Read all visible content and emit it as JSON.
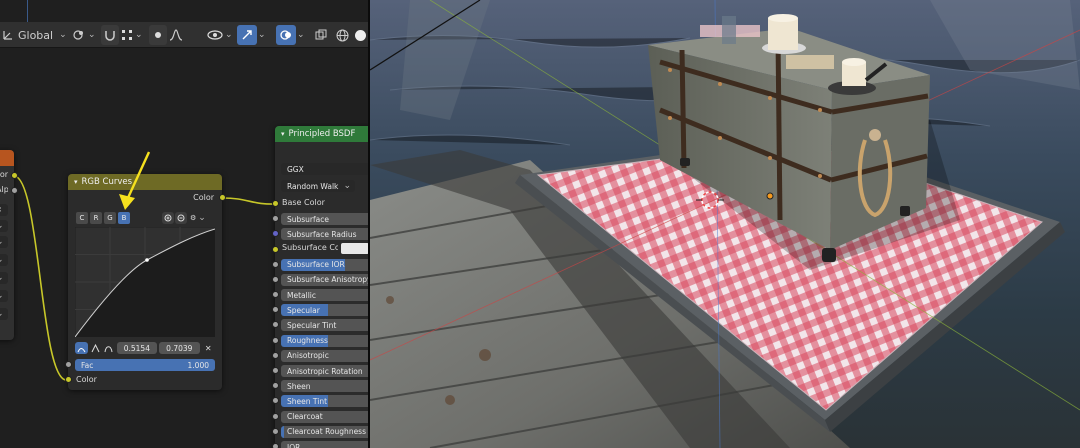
{
  "header": {
    "transform_orientation": "Global"
  },
  "left_node_fragment": {
    "label_color": "Color",
    "label_alpha": "Alpha"
  },
  "rgb_curves": {
    "title": "RGB Curves",
    "channels": [
      "C",
      "R",
      "G",
      "B"
    ],
    "active_channel": "B",
    "output_label": "Color",
    "point_x": "0.5154",
    "point_y": "0.7039",
    "fac_label": "Fac",
    "fac_value": "1.000",
    "input_color_label": "Color"
  },
  "principled_bsdf": {
    "title": "Principled BSDF",
    "distribution": "GGX",
    "subsurface_method": "Random Walk",
    "base_color_label": "Base Color",
    "subsurface_color_label": "Subsurface Co...",
    "inputs": [
      {
        "label": "Subsurface",
        "fill": 0.0
      },
      {
        "label": "Subsurface Radius",
        "fill": 0.0
      },
      {
        "label": "Subsurface IOR",
        "fill": 0.68
      },
      {
        "label": "Subsurface Anisotropy",
        "fill": 0.0
      },
      {
        "label": "Metallic",
        "fill": 0.0
      },
      {
        "label": "Specular",
        "fill": 0.5
      },
      {
        "label": "Specular Tint",
        "fill": 0.0
      },
      {
        "label": "Roughness",
        "fill": 0.5
      },
      {
        "label": "Anisotropic",
        "fill": 0.0
      },
      {
        "label": "Anisotropic Rotation",
        "fill": 0.0
      },
      {
        "label": "Sheen",
        "fill": 0.0
      },
      {
        "label": "Sheen Tint",
        "fill": 0.5
      },
      {
        "label": "Clearcoat",
        "fill": 0.0
      },
      {
        "label": "Clearcoat Roughness",
        "fill": 0.03
      },
      {
        "label": "IOR",
        "fill": 0.0
      }
    ]
  },
  "colors": {
    "accent": "#4772b3",
    "color_socket": "#c7c729",
    "value_socket": "#a1a1a1",
    "vector_socket": "#6363c7",
    "curves_header": "#6e6a25",
    "bsdf_header": "#2f7a3a",
    "annotation_arrow": "#f5e01e"
  }
}
